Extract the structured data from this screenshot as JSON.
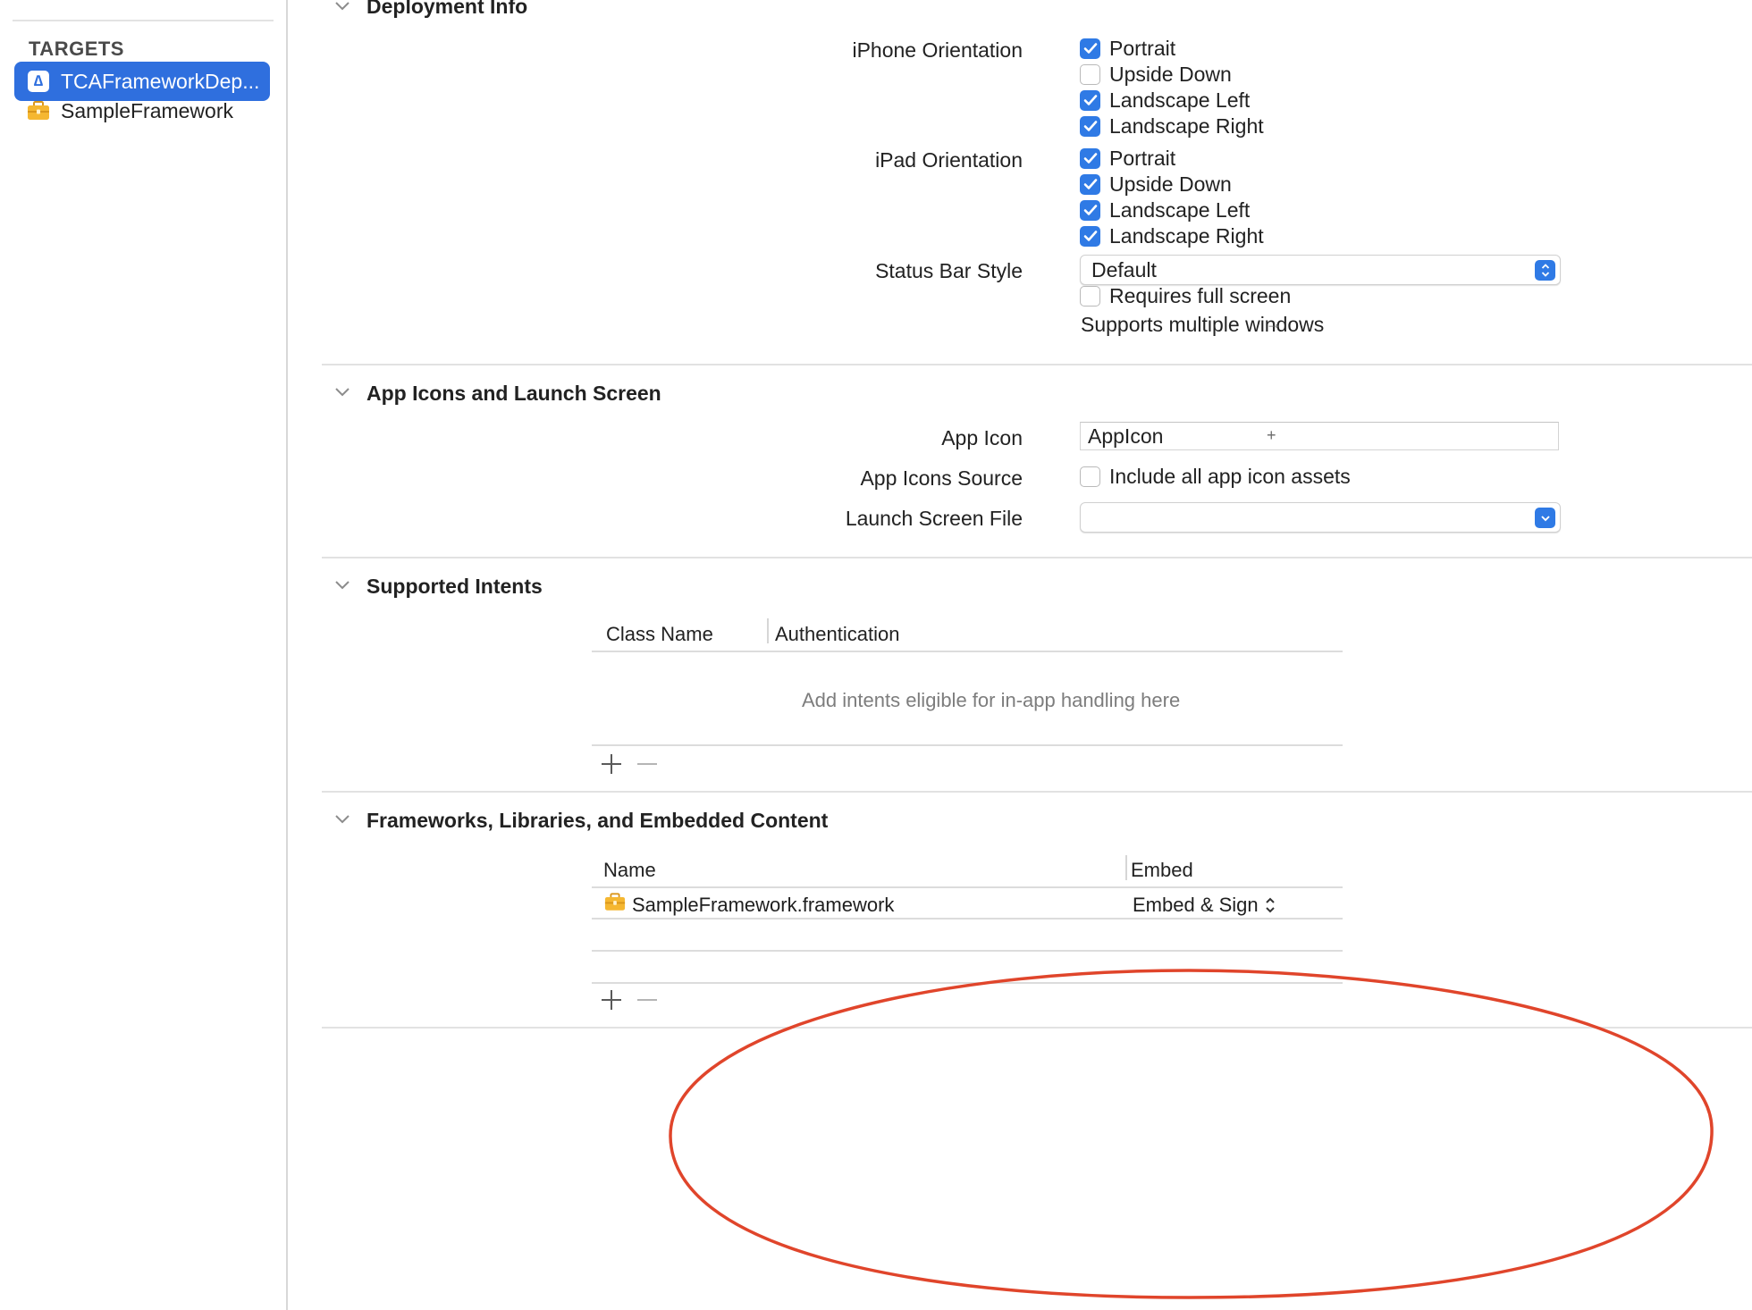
{
  "sidebar": {
    "heading": "TARGETS",
    "items": [
      {
        "label": "TCAFrameworkDep...",
        "icon": "app-target-icon",
        "selected": true
      },
      {
        "label": "SampleFramework",
        "icon": "framework-toolbox-icon",
        "selected": false
      }
    ]
  },
  "deployment_info": {
    "title": "Deployment Info",
    "iphone_orientation": {
      "label": "iPhone Orientation",
      "options": [
        {
          "label": "Portrait",
          "checked": true
        },
        {
          "label": "Upside Down",
          "checked": false
        },
        {
          "label": "Landscape Left",
          "checked": true
        },
        {
          "label": "Landscape Right",
          "checked": true
        }
      ]
    },
    "ipad_orientation": {
      "label": "iPad Orientation",
      "options": [
        {
          "label": "Portrait",
          "checked": true
        },
        {
          "label": "Upside Down",
          "checked": true
        },
        {
          "label": "Landscape Left",
          "checked": true
        },
        {
          "label": "Landscape Right",
          "checked": true
        }
      ]
    },
    "status_bar_style": {
      "label": "Status Bar Style",
      "value": "Default"
    },
    "requires_full_screen": {
      "label": "Requires full screen",
      "checked": false
    },
    "supports_multiple_windows": {
      "label": "Supports multiple windows"
    }
  },
  "app_icons": {
    "title": "App Icons and Launch Screen",
    "app_icon": {
      "label": "App Icon",
      "value": "AppIcon"
    },
    "app_icons_source": {
      "label": "App Icons Source",
      "checkbox_label": "Include all app icon assets",
      "checked": false
    },
    "launch_screen_file": {
      "label": "Launch Screen File",
      "value": ""
    }
  },
  "supported_intents": {
    "title": "Supported Intents",
    "columns": [
      "Class Name",
      "Authentication"
    ],
    "placeholder": "Add intents eligible for in-app handling here"
  },
  "frameworks": {
    "title": "Frameworks, Libraries, and Embedded Content",
    "columns": [
      "Name",
      "Embed"
    ],
    "rows": [
      {
        "name": "SampleFramework.framework",
        "embed": "Embed & Sign"
      }
    ]
  },
  "colors": {
    "accent": "#2f7ae5",
    "selection": "#2f6fde",
    "annotation": "#e0452b",
    "framework_icon": "#f5b731"
  }
}
